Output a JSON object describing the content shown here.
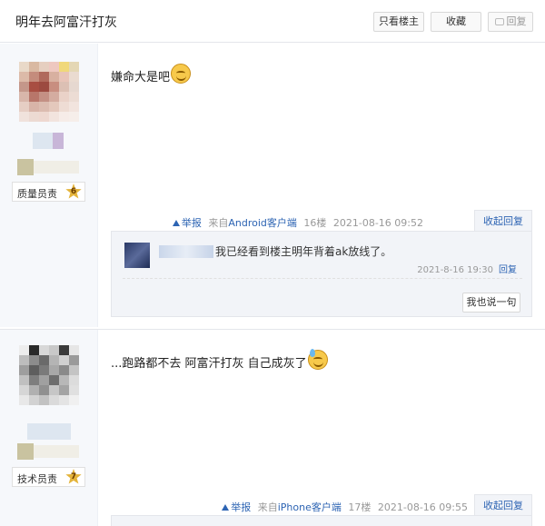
{
  "header": {
    "title": "明年去阿富汗打灰",
    "only_op_label": "只看楼主",
    "favorite_label": "收藏",
    "reply_label": "回复"
  },
  "posts": [
    {
      "badge_title": "质量员责",
      "badge_level": "6",
      "content": "嫌命大是吧",
      "emoji": "smile-emoji",
      "meta": {
        "report_label": "举报",
        "source_prefix": "来自",
        "source_client": "Android客户端",
        "floor": "16楼",
        "time": "2021-08-16 09:52",
        "collapse_label": "收起回复"
      },
      "comment": {
        "text": "我已经看到楼主明年背着ak放线了。",
        "time": "2021-8-16 19:30",
        "reply_label": "回复"
      },
      "say_label": "我也说一句"
    },
    {
      "badge_title": "技术员责",
      "badge_level": "7",
      "content": "...跑路都不去 阿富汗打灰 自己成灰了",
      "emoji": "sweat-emoji",
      "meta": {
        "report_label": "举报",
        "source_prefix": "来自",
        "source_client": "iPhone客户端",
        "floor": "17楼",
        "time": "2021-08-16 09:55",
        "collapse_label": "收起回复"
      }
    }
  ],
  "colors": {
    "link": "#2d64b3",
    "muted": "#999999",
    "badge_star": "#e4b43a"
  }
}
